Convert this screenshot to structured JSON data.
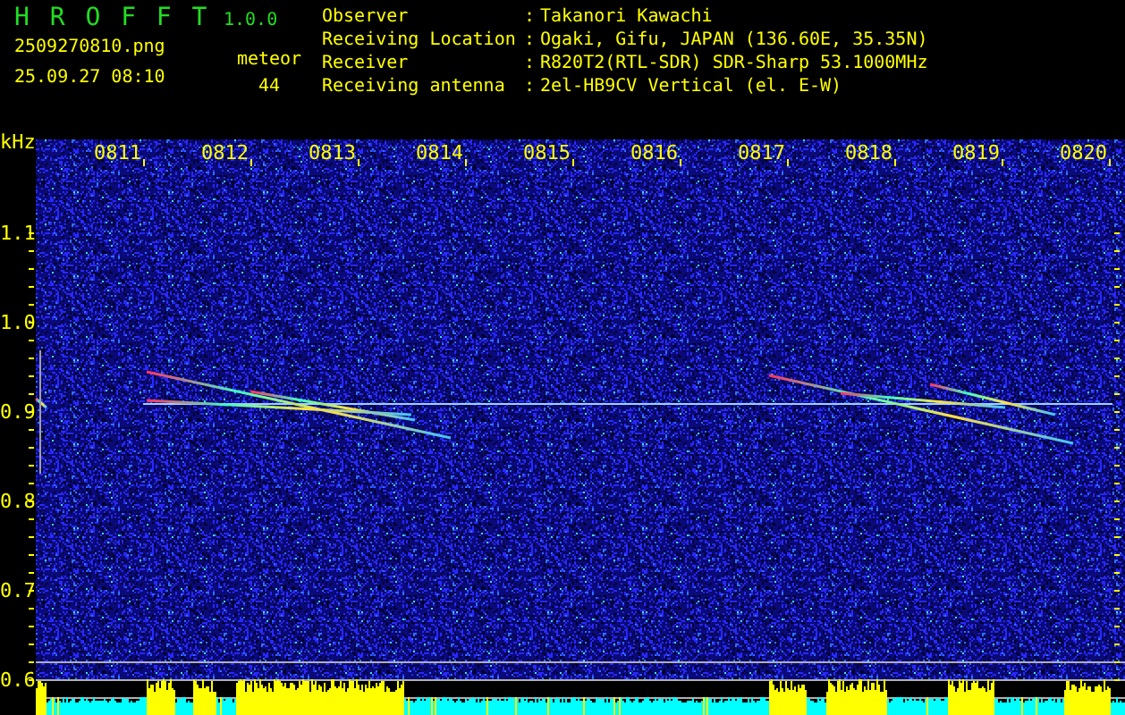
{
  "app": {
    "title": "H R O F F T",
    "version": "1.0.0"
  },
  "file": {
    "name": "2509270810.png",
    "datetime": "25.09.27 08:10"
  },
  "detection": {
    "label": "meteor",
    "count": "44"
  },
  "station": [
    {
      "label": "Observer",
      "separator": ":",
      "value": "Takanori Kawachi"
    },
    {
      "label": "Receiving Location",
      "separator": ":",
      "value": "Ogaki, Gifu, JAPAN (136.60E, 35.35N)"
    },
    {
      "label": "Receiver",
      "separator": ":",
      "value": "R820T2(RTL-SDR) SDR-Sharp 53.1000MHz"
    },
    {
      "label": "Receiving antenna",
      "separator": ":",
      "value": "2el-HB9CV Vertical (el. E-W)"
    }
  ],
  "spectrogram": {
    "unit": "kHz",
    "freq_ticks": [
      "1.1",
      "1.0",
      "0.9",
      "0.8",
      "0.7",
      "0.6"
    ],
    "time_ticks": [
      "0811",
      "0812",
      "0813",
      "0814",
      "0815",
      "0816",
      "0817",
      "0818",
      "0819",
      "0820"
    ]
  }
}
